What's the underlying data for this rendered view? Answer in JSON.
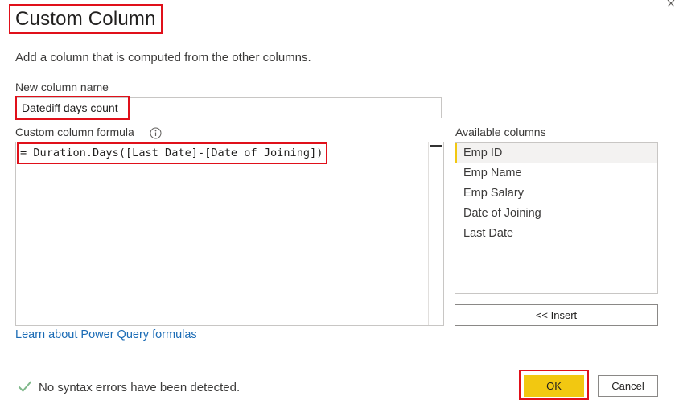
{
  "dialog": {
    "title": "Custom Column",
    "description": "Add a column that is computed from the other columns.",
    "close_icon": "close-icon"
  },
  "column_name": {
    "label": "New column name",
    "value": "Datediff days count"
  },
  "formula": {
    "label": "Custom column formula",
    "info_icon": "info-icon",
    "value": "= Duration.Days([Last Date]-[Date of Joining])"
  },
  "available_columns": {
    "label": "Available columns",
    "items": [
      "Emp ID",
      "Emp Name",
      "Emp Salary",
      "Date of Joining",
      "Last Date"
    ],
    "selected": "Emp ID",
    "insert_label": "<< Insert"
  },
  "learn_link": "Learn about Power Query formulas",
  "status": {
    "icon": "checkmark-icon",
    "text": "No syntax errors have been detected."
  },
  "buttons": {
    "ok": "OK",
    "cancel": "Cancel"
  },
  "colors": {
    "accent": "#f2c811",
    "highlight": "#e0101a",
    "link": "#1a6bb5",
    "success": "#7fb88a"
  }
}
